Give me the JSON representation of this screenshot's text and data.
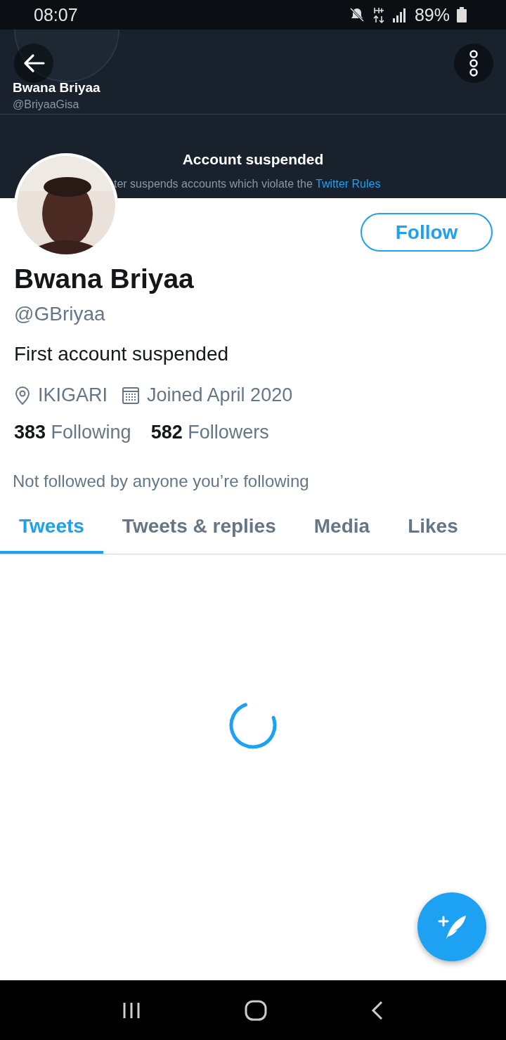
{
  "status_bar": {
    "time": "08:07",
    "battery": "89%"
  },
  "banner": {
    "kind": "screenshot",
    "name": "Bwana Briyaa",
    "handle": "@BriyaaGisa",
    "title": "Account suspended",
    "message": "ter suspends accounts which violate the",
    "link": "Twitter Rules"
  },
  "profile": {
    "name": "Bwana Briyaa",
    "handle": "@GBriyaa",
    "bio": "First account suspended",
    "location": "IKIGARI",
    "joined": "Joined April 2020",
    "following_count": "383",
    "following_label": "Following",
    "followers_count": "582",
    "followers_label": "Followers",
    "followed_by": "Not followed by anyone you’re following",
    "follow_button": "Follow"
  },
  "tabs": [
    {
      "label": "Tweets",
      "selected": true
    },
    {
      "label": "Tweets & replies",
      "selected": false
    },
    {
      "label": "Media",
      "selected": false
    },
    {
      "label": "Likes",
      "selected": false
    }
  ],
  "loading": true
}
